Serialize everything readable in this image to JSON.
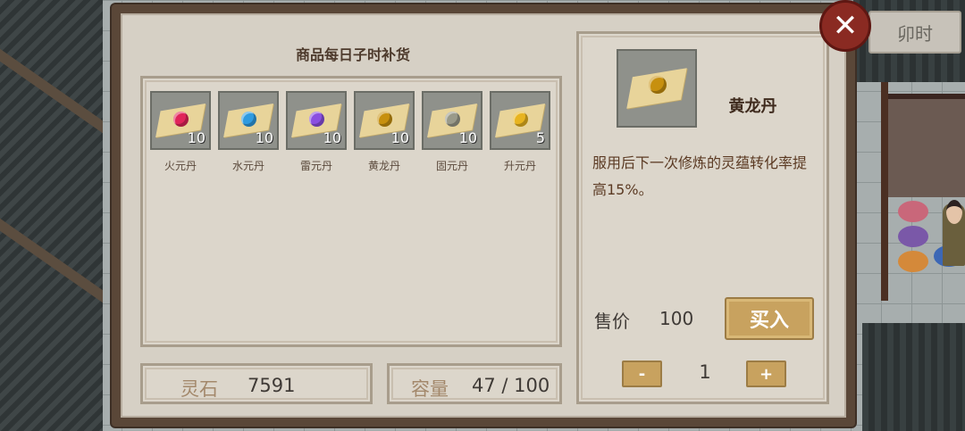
{
  "hud": {
    "time_label": "卯时"
  },
  "shop": {
    "restock_note": "商品每日子时补货",
    "items": [
      {
        "name": "火元丹",
        "qty": "10",
        "color": "#e0245a"
      },
      {
        "name": "水元丹",
        "qty": "10",
        "color": "#2f9be0"
      },
      {
        "name": "雷元丹",
        "qty": "10",
        "color": "#8a4fe0"
      },
      {
        "name": "黄龙丹",
        "qty": "10",
        "color": "#c7900f"
      },
      {
        "name": "固元丹",
        "qty": "10",
        "color": "#9a9a8a"
      },
      {
        "name": "升元丹",
        "qty": "5",
        "color": "#e8b420"
      }
    ]
  },
  "footer": {
    "spirit_stone_label": "灵石",
    "spirit_stone_value": "7591",
    "capacity_label": "容量",
    "capacity_value": "47 / 100"
  },
  "detail": {
    "name": "黄龙丹",
    "icon_color": "#c7900f",
    "description": "服用后下一次修炼的灵蕴转化率提高15%。",
    "price_label": "售价",
    "price_value": "100",
    "buy_label": "买入",
    "minus_label": "-",
    "plus_label": "+",
    "quantity": "1"
  },
  "close_label": "✕"
}
